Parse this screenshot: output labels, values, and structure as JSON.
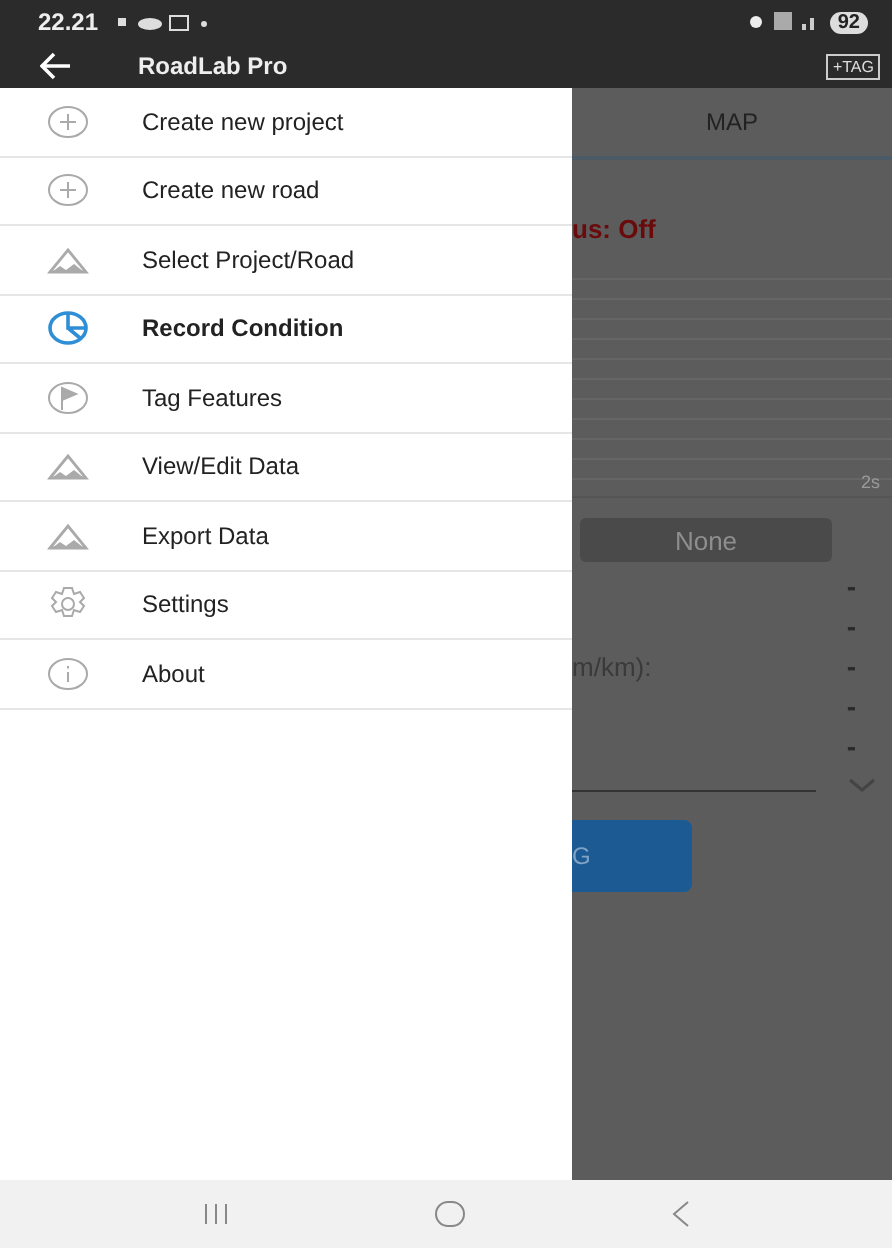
{
  "status_bar": {
    "time": "22.21",
    "battery": "92"
  },
  "app_bar": {
    "title": "RoadLab Pro",
    "action": "+TAG"
  },
  "drawer": {
    "items": [
      {
        "label": "Create new project",
        "kind": "plus",
        "selected": false
      },
      {
        "label": "Create new road",
        "kind": "plus",
        "selected": false
      },
      {
        "label": "Select Project/Road",
        "kind": "mountain",
        "selected": false
      },
      {
        "label": "Record Condition",
        "kind": "pie",
        "selected": true
      },
      {
        "label": "Tag Features",
        "kind": "flag",
        "selected": false
      },
      {
        "label": "View/Edit Data",
        "kind": "mountain",
        "selected": false
      },
      {
        "label": "Export Data",
        "kind": "mountain",
        "selected": false
      },
      {
        "label": "Settings",
        "kind": "gear",
        "selected": false
      },
      {
        "label": "About",
        "kind": "info",
        "selected": false
      }
    ]
  },
  "background": {
    "tab": "MAP",
    "status": "us: Off",
    "chart_tick": "2s",
    "mode_button": "None",
    "readings": [
      "-",
      "-",
      "-",
      "-",
      "-"
    ],
    "reading_label": "m/km):",
    "start_button": "G"
  }
}
